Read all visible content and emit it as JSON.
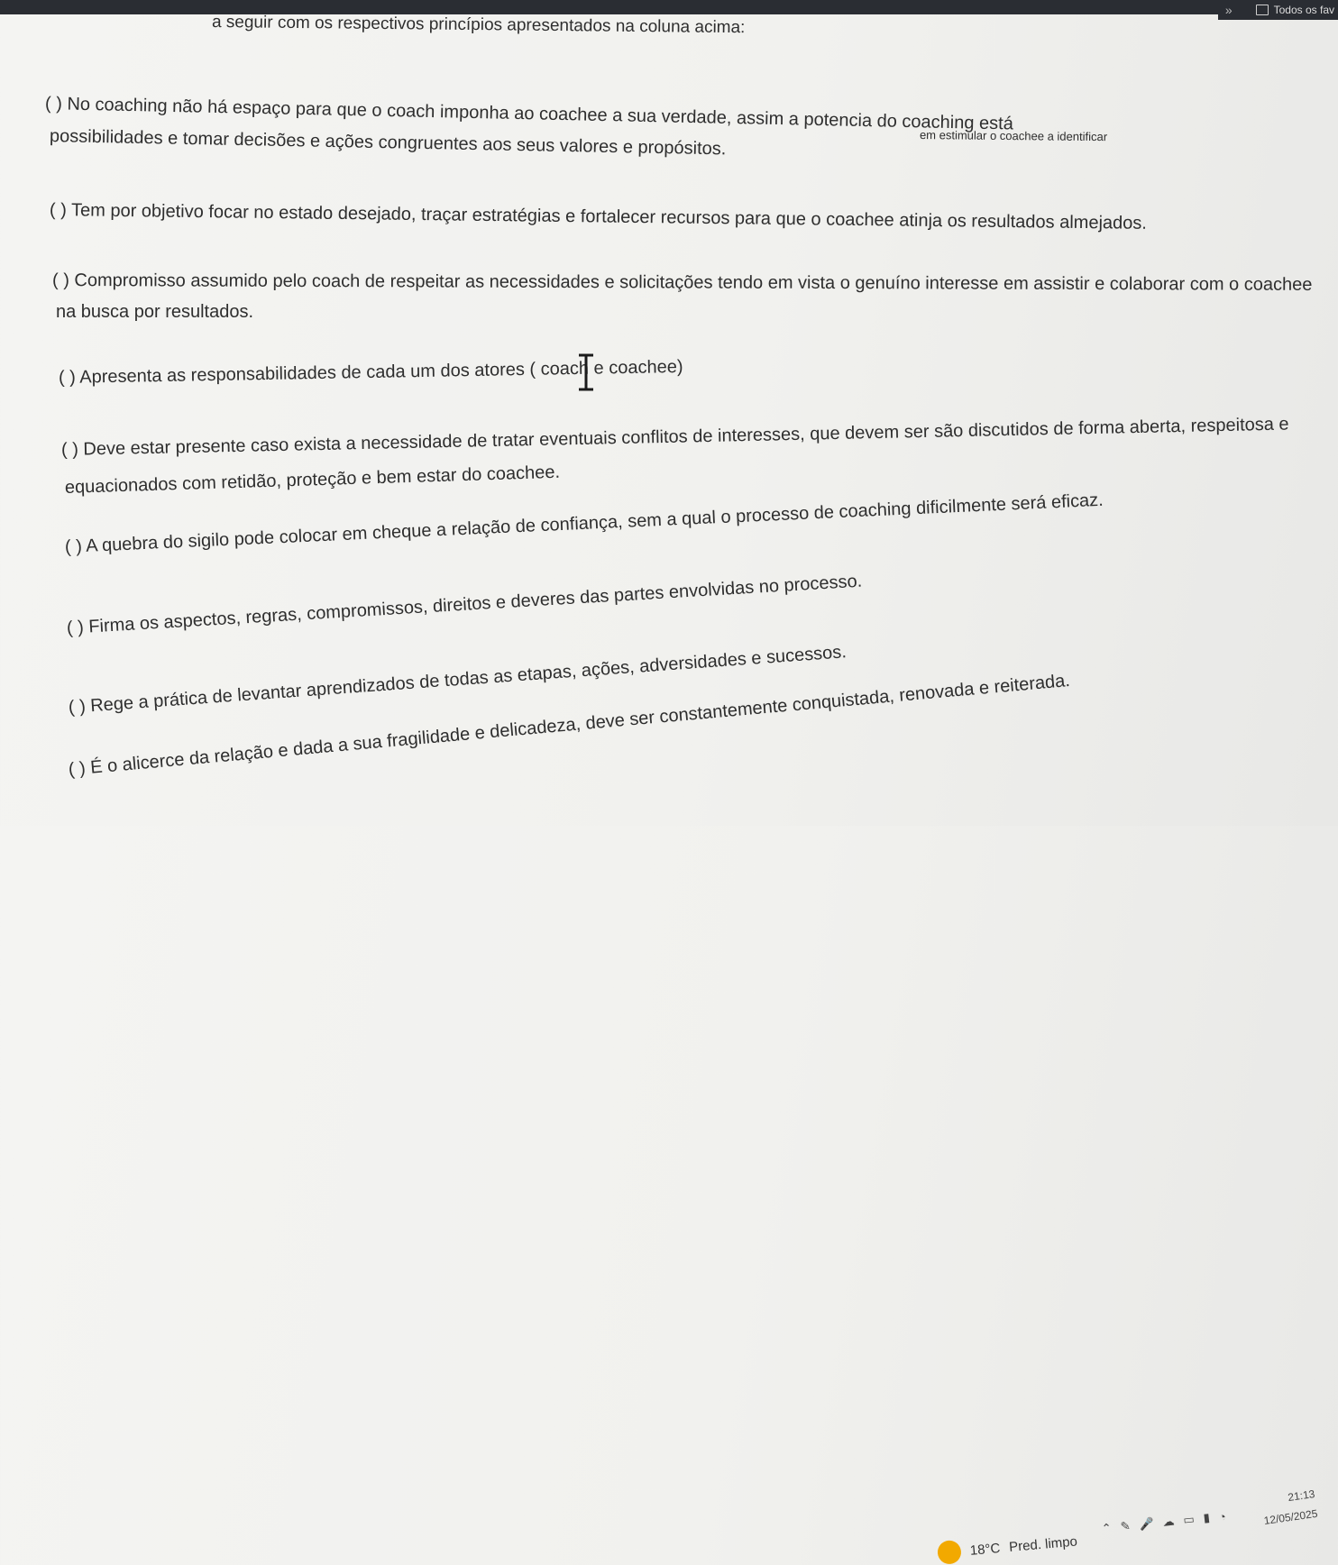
{
  "browser": {
    "bookmarks_label": "Todos os fav"
  },
  "document": {
    "lines": [
      "a seguir com os respectivos princípios apresentados na coluna acima:",
      "( ) No coaching não há espaço para que o coach imponha ao coachee a sua verdade, assim a potencia do coaching está",
      "em estimular o coachee a identificar",
      "possibilidades e tomar decisões e ações congruentes aos seus valores e propósitos.",
      "( ) Tem por objetivo focar no estado desejado, traçar estratégias e fortalecer recursos para que o coachee atinja os resultados almejados.",
      "( ) Compromisso assumido pelo coach  de respeitar as necessidades e solicitações tendo em vista o genuíno interesse em assistir e colaborar com o coachee",
      "na busca por resultados.",
      "( ) Apresenta as responsabilidades de cada um dos atores ( coach e coachee)",
      "( ) Deve estar presente caso exista a necessidade de tratar eventuais conflitos de interesses, que devem ser  são discutidos de forma aberta, respeitosa e",
      "equacionados com retidão, proteção e bem estar do coachee.",
      "( ) A quebra  do sigilo pode colocar em cheque a relação de confiança, sem a qual o processo de coaching dificilmente será eficaz.",
      "( ) Firma os aspectos, regras, compromissos, direitos e deveres das partes envolvidas no processo.",
      "( ) Rege a prática de levantar aprendizados de todas as etapas, ações, adversidades e sucessos.",
      "( ) É o alicerce da relação e dada a sua fragilidade e delicadeza, deve ser constantemente conquistada, renovada e reiterada."
    ]
  },
  "taskbar": {
    "temperature": "18°C",
    "weather": "Pred. limpo",
    "time": "21:13",
    "date": "12/05/2025"
  },
  "colors": {
    "text": "#2e2e2e",
    "topbar": "#2a2d33",
    "sun": "#f2a900"
  }
}
